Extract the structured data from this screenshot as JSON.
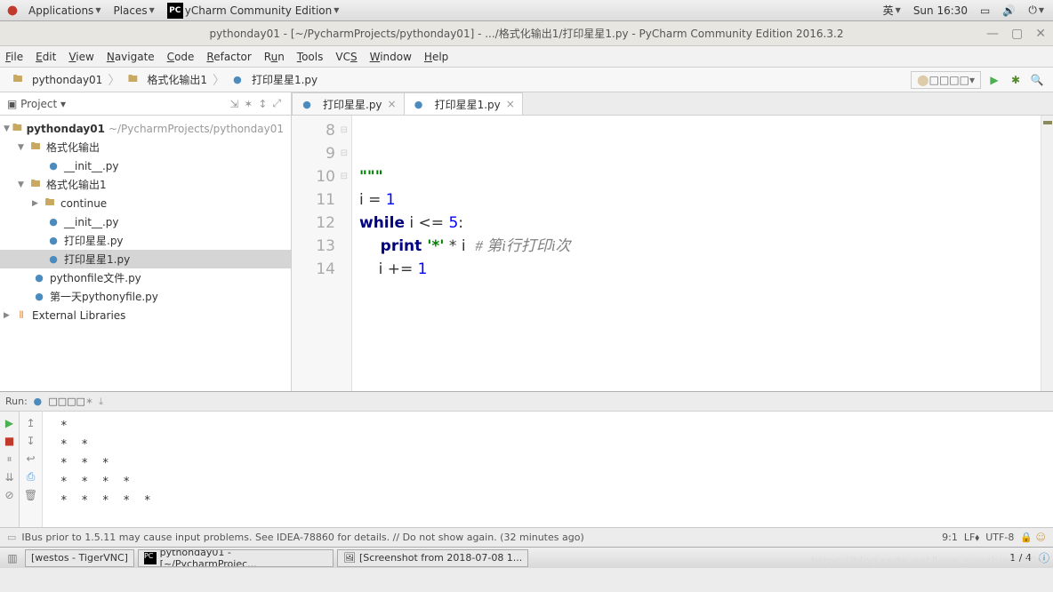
{
  "sysbar": {
    "apps": "Applications",
    "places": "Places",
    "app_label": "yCharm Community Edition",
    "lang": "英",
    "clock": "Sun 16:30"
  },
  "wintitle": "pythonday01 - [~/PycharmProjects/pythonday01] - .../格式化输出1/打印星星1.py - PyCharm Community Edition 2016.3.2",
  "menu": [
    "File",
    "Edit",
    "View",
    "Navigate",
    "Code",
    "Refactor",
    "Run",
    "Tools",
    "VCS",
    "Window",
    "Help"
  ],
  "breadcrumb": {
    "b1": "pythonday01",
    "b2": "格式化输出1",
    "b3": "打印星星1.py"
  },
  "run_config": "□□□□",
  "project": {
    "header": "Project",
    "root": "pythonday01",
    "root_path": "~/PycharmProjects/pythonday01",
    "dir1": "格式化输出",
    "init1": "__init__.py",
    "dir2": "格式化输出1",
    "cont": "continue",
    "init2": "__init__.py",
    "file_star": "打印星星.py",
    "file_star1": "打印星星1.py",
    "file_pf": "pythonfile文件.py",
    "file_day1": "第一天pythonyfile.py",
    "ext_libs": "External Libraries"
  },
  "tabs": {
    "t1": "打印星星.py",
    "t2": "打印星星1.py"
  },
  "code": {
    "lines": [
      "8",
      "9",
      "10",
      "11",
      "12",
      "13",
      "14"
    ],
    "l10": "\"\"\"",
    "l11_a": "i = ",
    "l11_b": "1",
    "l12_a": "while",
    "l12_b": " i <= ",
    "l12_c": "5",
    "l12_d": ":",
    "l13_a": "    print ",
    "l13_b": "'*'",
    "l13_c": " * i  ",
    "l13_d": "# 第i行打印i次",
    "l14_a": "    i += ",
    "l14_b": "1"
  },
  "run": {
    "label": "Run:",
    "name": "□□□□",
    "output": " *\n *  *\n *  *  *\n *  *  *  *\n *  *  *  *  *"
  },
  "status": {
    "msg": "IBus prior to 1.5.11 may cause input problems. See IDEA-78860 for details. // Do not show again. (32 minutes ago)",
    "pos": "9:1",
    "sep": "LF⬧",
    "enc": "UTF-8"
  },
  "taskbar": {
    "t1": "[westos - TigerVNC]",
    "t2": "pythonday01 - [~/PycharmProjec...",
    "t3": "[Screenshot from 2018-07-08 1...",
    "tray": "1 / 4"
  },
  "watermark": "https://blog.csdn.net/love_sunshine_999"
}
